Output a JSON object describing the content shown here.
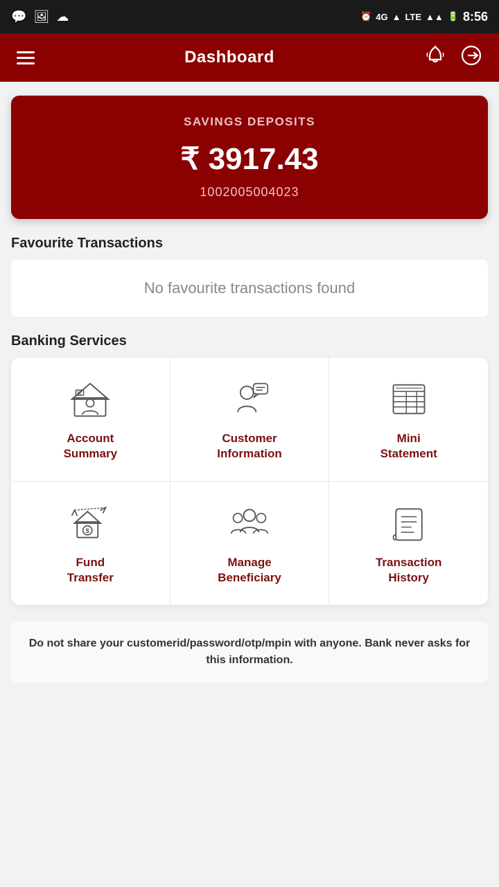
{
  "statusBar": {
    "time": "8:56",
    "network": "4G",
    "carrier": "LTE"
  },
  "header": {
    "title": "Dashboard",
    "menuIcon": "≡",
    "bellIcon": "🔔",
    "logoutIcon": "⏻"
  },
  "savingsCard": {
    "label": "SAVINGS DEPOSITS",
    "amount": "₹ 3917.43",
    "accountNumber": "1002005004023"
  },
  "favouriteSection": {
    "title": "Favourite Transactions",
    "emptyMessage": "No favourite transactions found"
  },
  "bankingSection": {
    "title": "Banking Services",
    "services": [
      {
        "id": "account-summary",
        "label": "Account\nSummary",
        "icon": "account"
      },
      {
        "id": "customer-information",
        "label": "Customer\nInformation",
        "icon": "customer"
      },
      {
        "id": "mini-statement",
        "label": "Mini\nStatement",
        "icon": "mini-statement"
      },
      {
        "id": "fund-transfer",
        "label": "Fund\nTransfer",
        "icon": "fund-transfer"
      },
      {
        "id": "manage-beneficiary",
        "label": "Manage\nBeneficiary",
        "icon": "beneficiary"
      },
      {
        "id": "transaction-history",
        "label": "Transaction\nHistory",
        "icon": "transaction"
      }
    ]
  },
  "securityNotice": {
    "text": "Do not share your customerid/password/otp/mpin with anyone. Bank never asks for this information."
  }
}
